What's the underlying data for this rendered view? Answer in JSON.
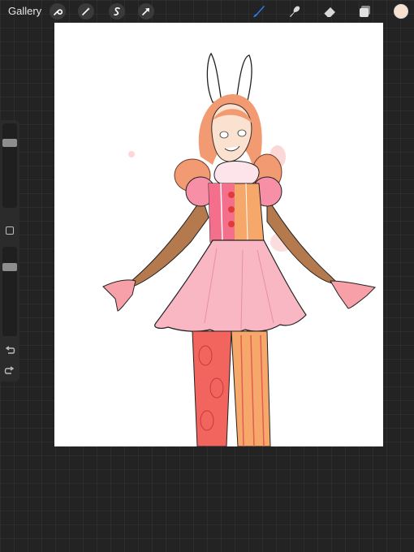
{
  "toolbar": {
    "gallery_label": "Gallery",
    "left_tools": [
      "wrench-icon",
      "magic-wand-icon",
      "selection-icon",
      "transform-arrow-icon"
    ],
    "right_tools": [
      "brush-icon",
      "smudge-icon",
      "eraser-icon",
      "layers-icon"
    ],
    "active_tool": "brush",
    "accent_color": "#2f7cf6",
    "current_color": "#f7e0cf"
  },
  "sidebar": {
    "brush_size_level": 0.2,
    "opacity_level": 0.2,
    "buttons": [
      "modify-button",
      "undo-arrow-icon",
      "redo-arrow-icon"
    ]
  },
  "canvas": {
    "background": "#ffffff",
    "artwork": "illustration"
  }
}
